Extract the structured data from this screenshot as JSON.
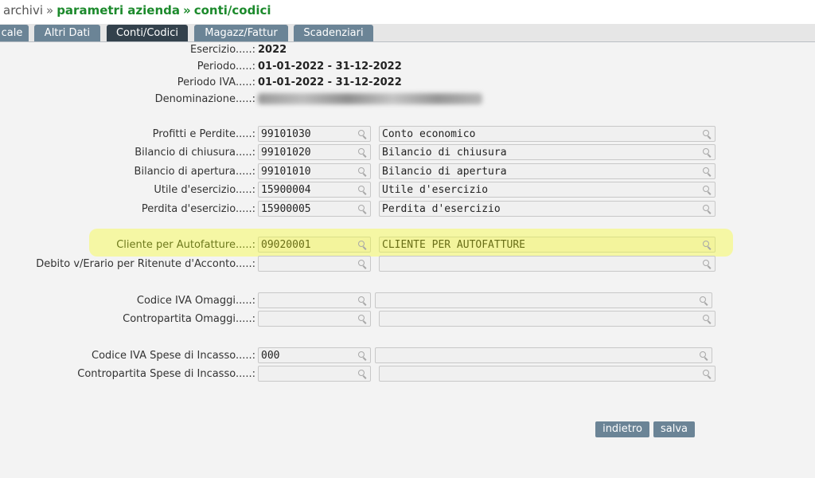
{
  "breadcrumb": {
    "root": "archivi",
    "sep": "»",
    "level1": "parametri azienda",
    "level2": "conti/codici"
  },
  "tabs": [
    {
      "label": "cale"
    },
    {
      "label": "Altri Dati"
    },
    {
      "label": "Conti/Codici",
      "active": true
    },
    {
      "label": "Magazz/Fattur"
    },
    {
      "label": "Scadenziari"
    }
  ],
  "info": {
    "esercizio_label": "Esercizio.....:",
    "esercizio_value": "2022",
    "periodo_label": "Periodo.....:",
    "periodo_value": "01-01-2022 - 31-12-2022",
    "periodo_iva_label": "Periodo IVA.....:",
    "periodo_iva_value": "01-01-2022 - 31-12-2022",
    "denominazione_label": "Denominazione.....:"
  },
  "rows": {
    "profitti": {
      "label": "Profitti e Perdite.....:",
      "code": "99101030",
      "desc": "Conto economico"
    },
    "chiusura": {
      "label": "Bilancio di chiusura.....:",
      "code": "99101020",
      "desc": "Bilancio di chiusura"
    },
    "apertura": {
      "label": "Bilancio di apertura.....:",
      "code": "99101010",
      "desc": "Bilancio di apertura"
    },
    "utile": {
      "label": "Utile d'esercizio.....:",
      "code": "15900004",
      "desc": "Utile d'esercizio"
    },
    "perdita": {
      "label": "Perdita d'esercizio.....:",
      "code": "15900005",
      "desc": "Perdita d'esercizio"
    },
    "cliente_autofatture": {
      "label": "Cliente per Autofatture.....:",
      "code": "09020001",
      "desc": "CLIENTE PER AUTOFATTURE"
    },
    "debito_erario": {
      "label": "Debito v/Erario per Ritenute d'Acconto.....:",
      "code": "",
      "desc": ""
    },
    "iva_omaggi": {
      "label": "Codice IVA Omaggi.....:",
      "code": "",
      "desc": ""
    },
    "contropartita_omaggi": {
      "label": "Contropartita Omaggi.....:",
      "code": "",
      "desc": ""
    },
    "iva_incasso": {
      "label": "Codice IVA Spese di Incasso.....:",
      "code": "000",
      "desc": ""
    },
    "contropartita_incasso": {
      "label": "Contropartita Spese di Incasso.....:",
      "code": "",
      "desc": ""
    }
  },
  "buttons": {
    "indietro": "indietro",
    "salva": "salva"
  },
  "colors": {
    "accent_green": "#1c8a2c",
    "tab": "#6b8496",
    "tab_active": "#33414c",
    "highlight": "#f5f7a4"
  }
}
